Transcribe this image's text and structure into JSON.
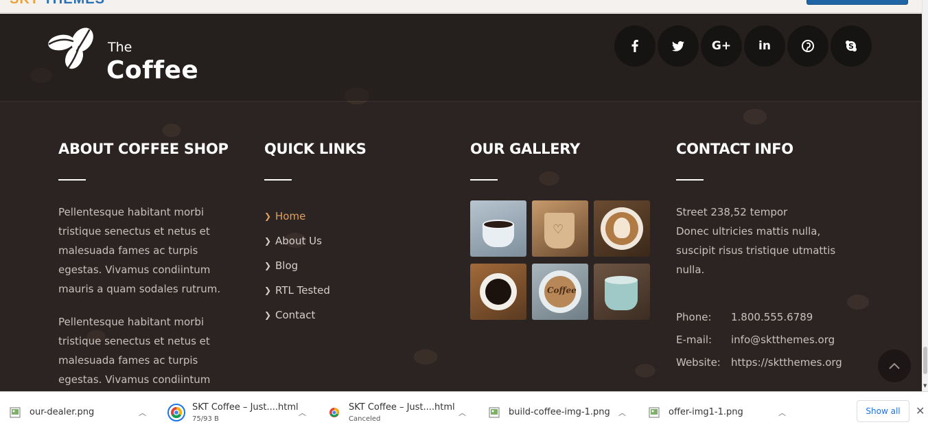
{
  "top": {
    "brand": "SKT",
    "brand2": "THEMES"
  },
  "logo": {
    "the": "The",
    "coffee": "Coffee",
    "icon": "coffee-beans-icon"
  },
  "social": [
    {
      "name": "facebook",
      "icon": "facebook-icon"
    },
    {
      "name": "twitter",
      "icon": "twitter-icon"
    },
    {
      "name": "google-plus",
      "icon": "google-plus-icon"
    },
    {
      "name": "linkedin",
      "icon": "linkedin-icon"
    },
    {
      "name": "pinterest",
      "icon": "pinterest-icon"
    },
    {
      "name": "skype",
      "icon": "skype-icon"
    }
  ],
  "about": {
    "title": "ABOUT COFFEE SHOP",
    "p1": "Pellentesque habitant morbi tristique senectus et netus et malesuada fames ac turpis egestas. Vivamus condiintum mauris a quam sodales rutrum.",
    "p2": "Pellentesque habitant morbi tristique senectus et netus et malesuada fames ac turpis egestas. Vivamus condiintum mauris a quam sodales"
  },
  "quick_links": {
    "title": "QUICK LINKS",
    "items": [
      "Home",
      "About Us",
      "Blog",
      "RTL Tested",
      "Contact"
    ],
    "active_color": "#e2a15c"
  },
  "gallery": {
    "title": "OUR GALLERY"
  },
  "contact": {
    "title": "CONTACT INFO",
    "address_line1": "Street 238,52 tempor",
    "address_line2": "Donec ultricies mattis nulla, suscipit risus tristique utmattis nulla.",
    "phone_label": "Phone:",
    "phone": "1.800.555.6789",
    "email_label": "E-mail:",
    "email": "info@sktthemes.org",
    "website_label": "Website:",
    "website": "https://sktthemes.org"
  },
  "downloads": {
    "items": [
      {
        "name": "our-dealer.png",
        "status": ""
      },
      {
        "name": "SKT Coffee – Just....html",
        "status": "75/93 B"
      },
      {
        "name": "SKT Coffee – Just....html",
        "status": "Canceled"
      },
      {
        "name": "build-coffee-img-1.png",
        "status": ""
      },
      {
        "name": "offer-img1-1.png",
        "status": ""
      }
    ],
    "show_all": "Show all",
    "close": "✕"
  }
}
